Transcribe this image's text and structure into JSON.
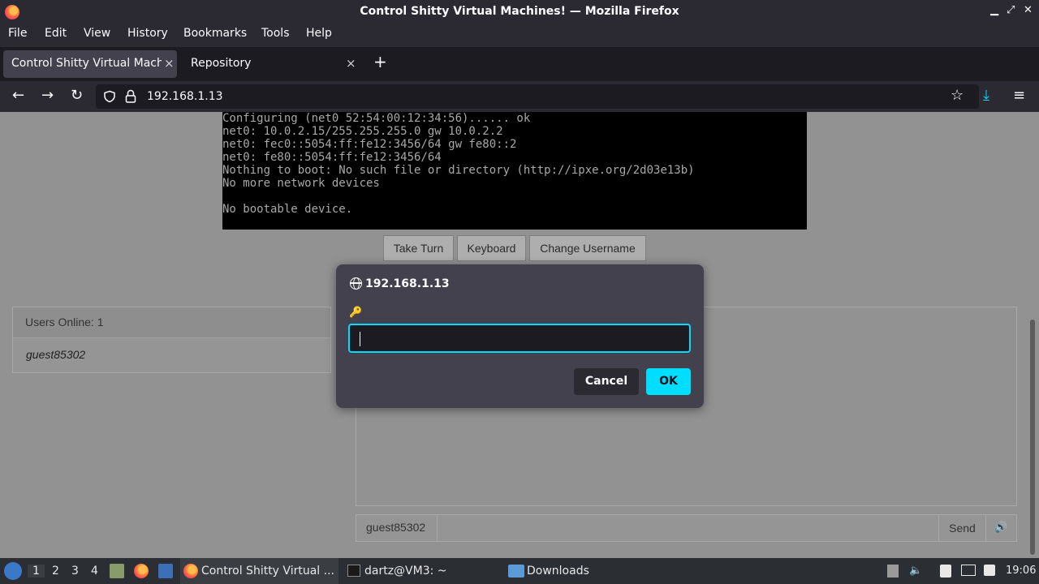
{
  "window": {
    "title": "Control Shitty Virtual Machines! — Mozilla Firefox",
    "minimize": "▁",
    "maximize": "⤢",
    "close": "✕"
  },
  "menu": [
    "File",
    "Edit",
    "View",
    "History",
    "Bookmarks",
    "Tools",
    "Help"
  ],
  "tabs": [
    {
      "label": "Control Shitty Virtual Machin",
      "active": true
    },
    {
      "label": "Repository",
      "active": false
    }
  ],
  "tab_close": "×",
  "new_tab": "+",
  "nav": {
    "back": "←",
    "forward": "→",
    "reload": "↻",
    "url": "192.168.1.13",
    "star": "☆",
    "download": "⤓",
    "menu": "≡"
  },
  "console_lines": [
    "Configuring (net0 52:54:00:12:34:56)...... ok",
    "net0: 10.0.2.15/255.255.255.0 gw 10.0.2.2",
    "net0: fec0::5054:ff:fe12:3456/64 gw fe80::2",
    "net0: fe80::5054:ff:fe12:3456/64",
    "Nothing to boot: No such file or directory (http://ipxe.org/2d03e13b)",
    "No more network devices",
    "",
    "No bootable device."
  ],
  "page_buttons": {
    "take_turn": "Take Turn",
    "keyboard": "Keyboard",
    "change_username": "Change Username"
  },
  "users": {
    "header": "Users Online: 1",
    "list": [
      "guest85302"
    ]
  },
  "chat": {
    "username": "guest85302",
    "send": "Send",
    "volume_icon": "🔊"
  },
  "dialog": {
    "title": "192.168.1.13",
    "key_icon": "🔑",
    "password_value": "",
    "cancel": "Cancel",
    "ok": "OK",
    "accent": "#00ddff"
  },
  "taskbar": {
    "workspaces": [
      "1",
      "2",
      "3",
      "4"
    ],
    "tasks": [
      {
        "label": "Control Shitty Virtual ...",
        "active": true
      },
      {
        "label": "dartz@VM3: ~",
        "active": false
      },
      {
        "label": "Downloads",
        "active": false
      }
    ],
    "clock": "19:06"
  }
}
